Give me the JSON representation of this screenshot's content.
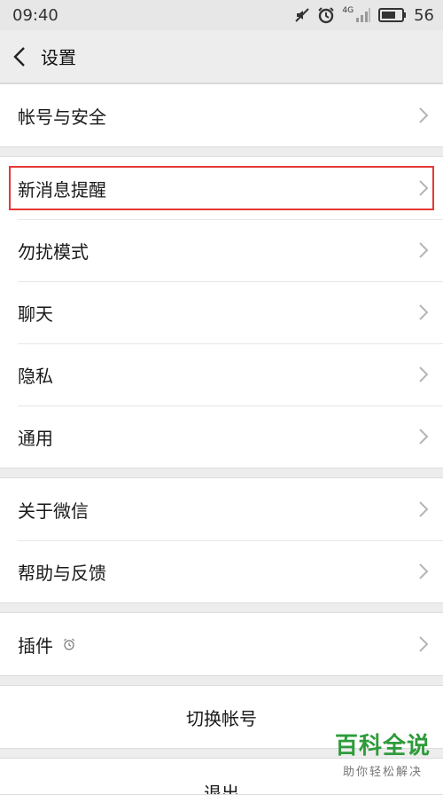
{
  "status": {
    "time": "09:40",
    "battery": "56",
    "network": "4G"
  },
  "nav": {
    "title": "设置"
  },
  "groups": [
    [
      {
        "label": "帐号与安全"
      }
    ],
    [
      {
        "label": "新消息提醒",
        "highlighted": true
      },
      {
        "label": "勿扰模式"
      },
      {
        "label": "聊天"
      },
      {
        "label": "隐私"
      },
      {
        "label": "通用"
      }
    ],
    [
      {
        "label": "关于微信"
      },
      {
        "label": "帮助与反馈"
      }
    ],
    [
      {
        "label": "插件",
        "icon": "plugin-clock-icon"
      }
    ]
  ],
  "actions": {
    "switch_account": "切换帐号",
    "logout": "退出"
  },
  "watermark": {
    "title": "百科全说",
    "subtitle": "助你轻松解决"
  },
  "colors": {
    "highlight": "#e53935",
    "watermark": "#2e9b3b"
  }
}
